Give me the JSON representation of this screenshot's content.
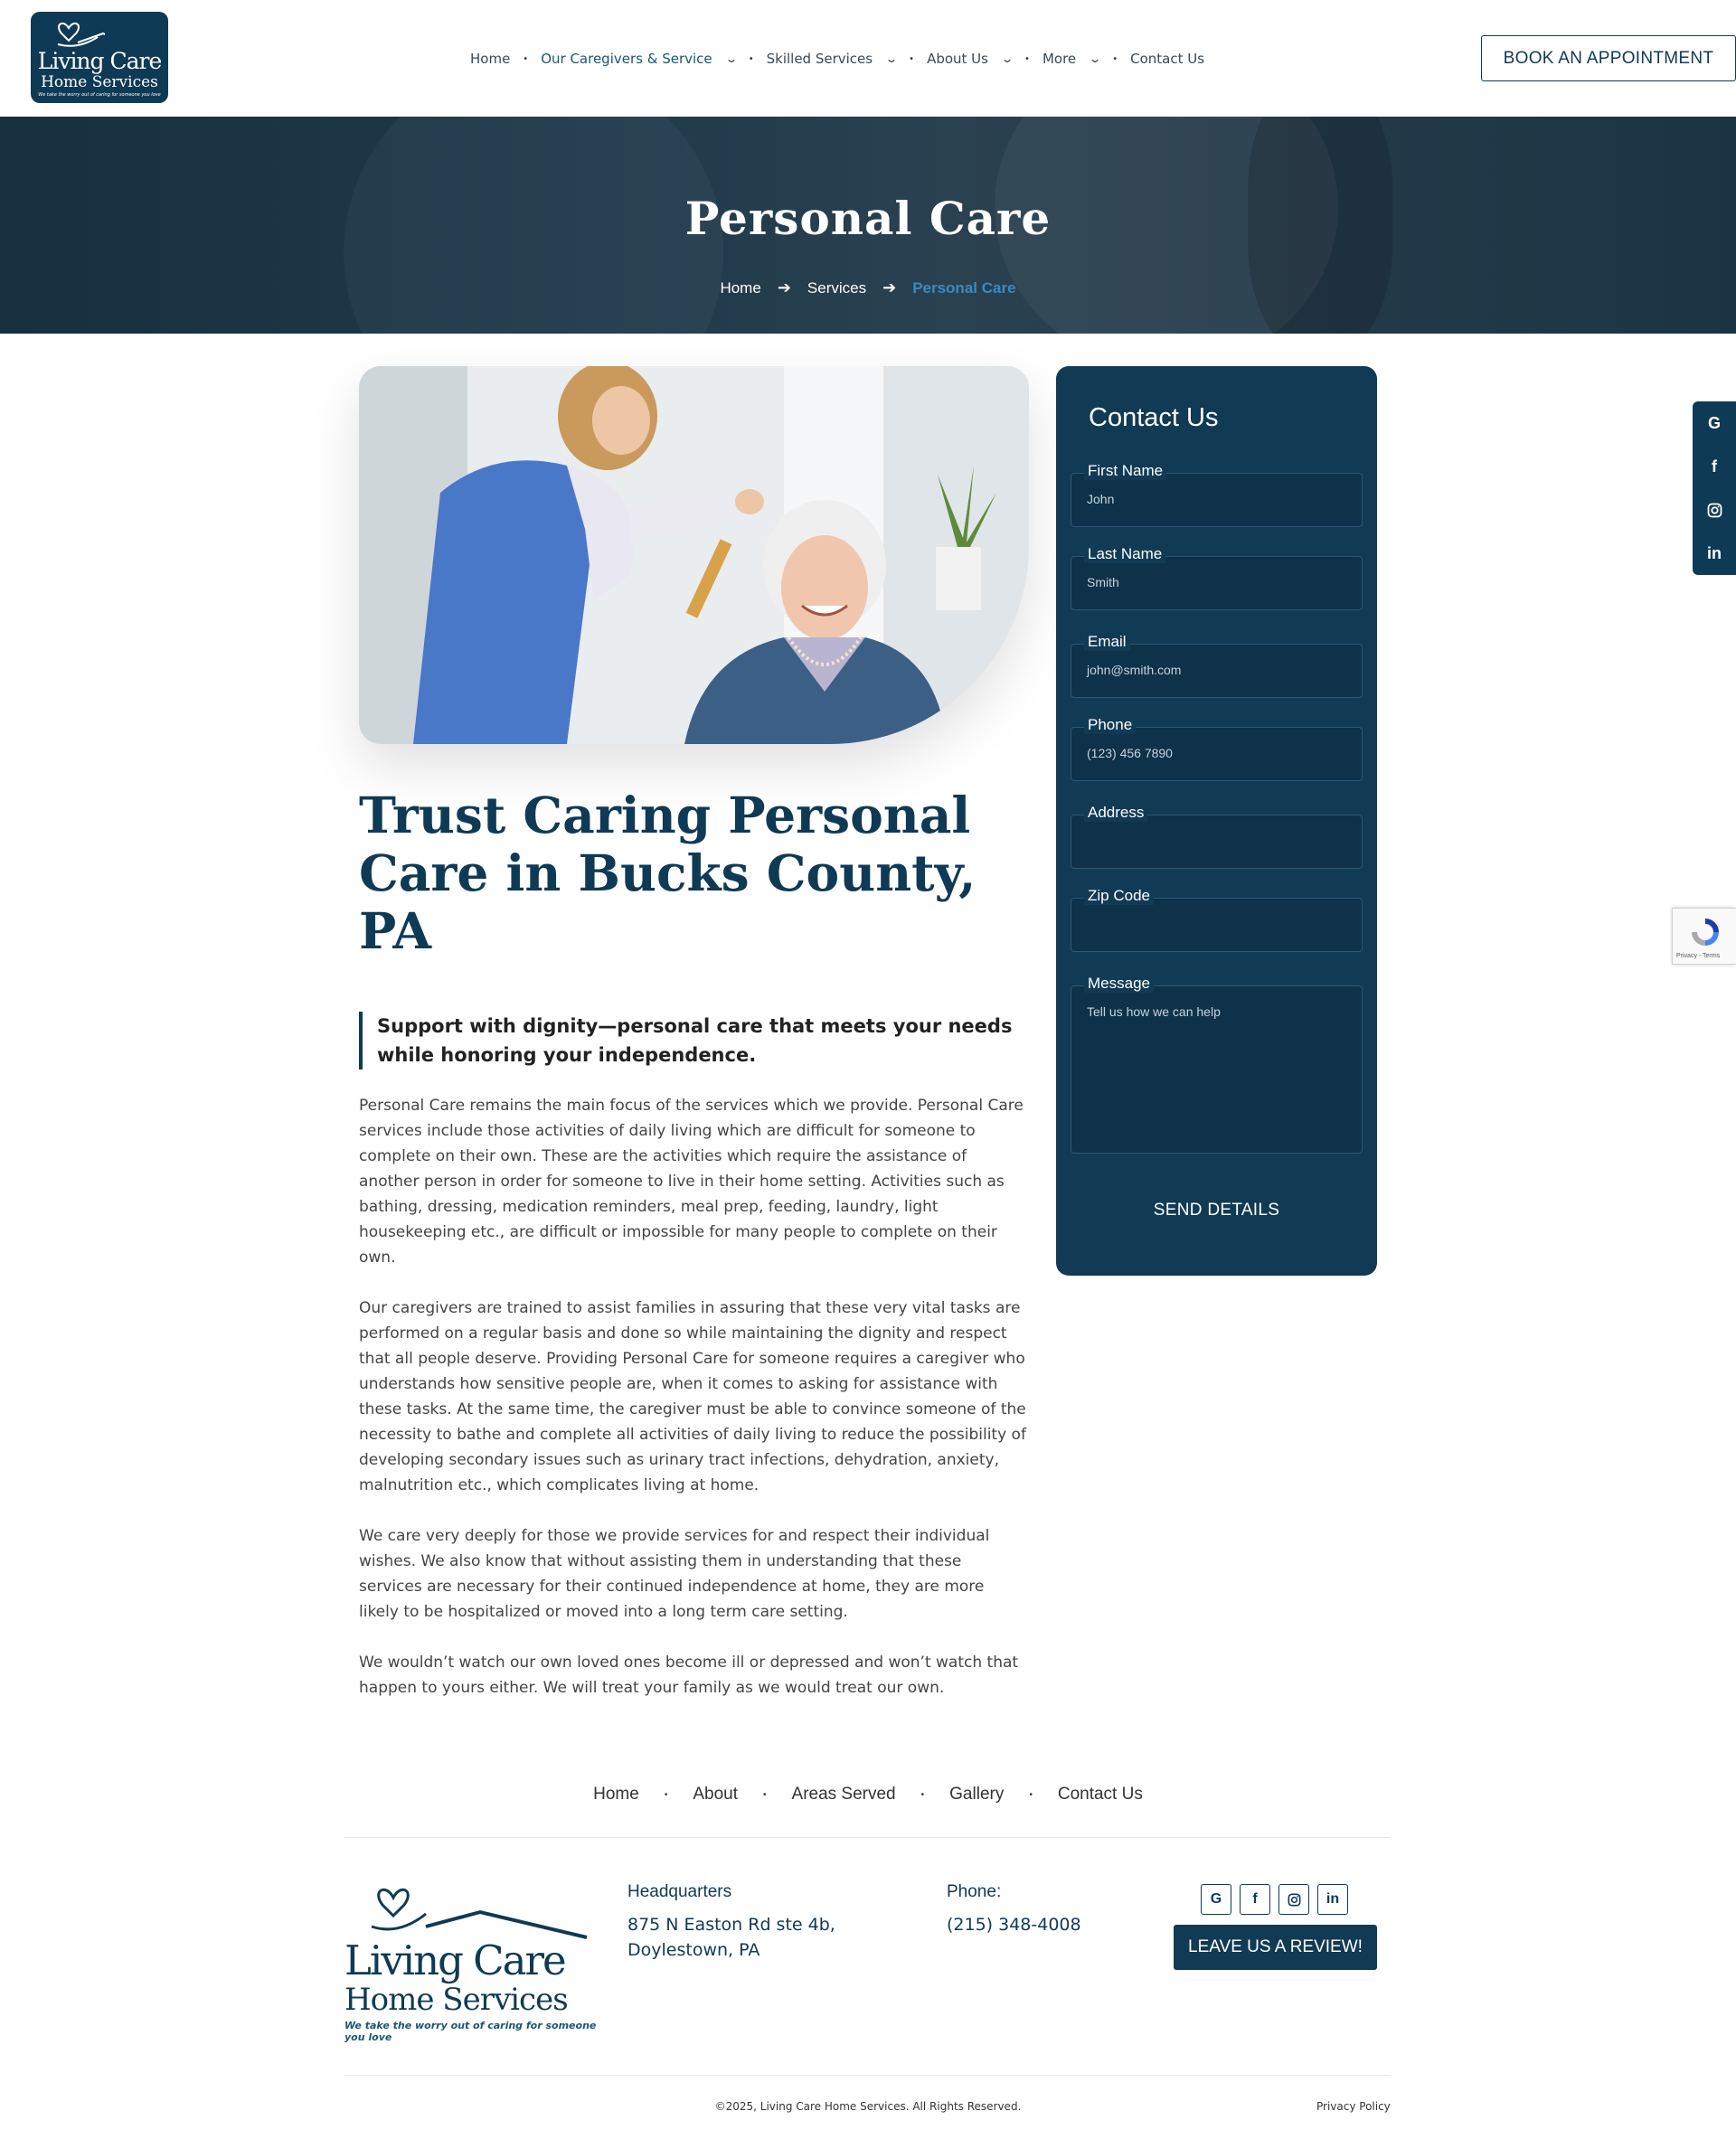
{
  "header": {
    "logo": {
      "line1": "Living Care",
      "line2": "Home Services",
      "tagline": "We take the worry out of caring for someone you love"
    },
    "nav": [
      {
        "label": "Home",
        "dropdown": false
      },
      {
        "label": "Our Caregivers & Service",
        "dropdown": true
      },
      {
        "label": "Skilled Services",
        "dropdown": true
      },
      {
        "label": "About Us",
        "dropdown": true
      },
      {
        "label": "More",
        "dropdown": true
      },
      {
        "label": "Contact Us",
        "dropdown": false
      }
    ],
    "book_label": "BOOK AN APPOINTMENT"
  },
  "hero": {
    "title": "Personal Care",
    "breadcrumb": [
      "Home",
      "Services",
      "Personal Care"
    ]
  },
  "article": {
    "title": "Trust Caring Personal Care in Bucks County, PA",
    "quote": "Support with dignity—personal care that meets your needs while honoring your independence.",
    "paragraphs": [
      "Personal Care remains the main focus of the services which we provide. Personal Care services include those activities of daily living which are difficult for someone to complete on their own. These are the activities which require the assistance of another person in order for someone to live in their home setting. Activities such as bathing, dressing, medication reminders, meal prep, feeding, laundry, light housekeeping etc., are difficult or impossible for many people to complete on their own.",
      "Our caregivers are trained to assist families in assuring that these very vital tasks are performed on a regular basis and done so while maintaining the dignity and respect that all people deserve. Providing Personal Care for someone requires a caregiver who understands how sensitive people are, when it comes to asking for assistance with these tasks. At the same time, the caregiver must be able to convince someone of the necessity to bathe and complete all activities of daily living to reduce the possibility of developing secondary issues such as urinary tract infections, dehydration, anxiety, malnutrition etc., which complicates living at home.",
      "We care very deeply for those we provide services for and respect their individual wishes. We also know that without assisting them in understanding that these services are necessary for their continued independence at home, they are more likely to be hospitalized or moved into a long term care setting.",
      "We wouldn’t watch our own loved ones become ill or depressed and won’t watch that happen to yours either. We will treat your family as we would treat our own."
    ]
  },
  "contact": {
    "title": "Contact Us",
    "fields": [
      {
        "label": "First Name",
        "placeholder": "John"
      },
      {
        "label": "Last Name",
        "placeholder": "Smith"
      },
      {
        "label": "Email",
        "placeholder": "john@smith.com"
      },
      {
        "label": "Phone",
        "placeholder": "(123) 456 7890"
      },
      {
        "label": "Address",
        "placeholder": ""
      },
      {
        "label": "Zip Code",
        "placeholder": ""
      },
      {
        "label": "Message",
        "placeholder": "Tell us how we can help"
      }
    ],
    "send_label": "SEND DETAILS"
  },
  "side_social": [
    "G",
    "f",
    "instagram",
    "in"
  ],
  "recaptcha": {
    "text": "Privacy - Terms"
  },
  "footer": {
    "nav": [
      "Home",
      "About",
      "Areas Served",
      "Gallery",
      "Contact Us"
    ],
    "logo": {
      "line1": "Living Care",
      "line2": "Home Services",
      "tagline": "We take the worry out of caring for someone you love"
    },
    "hq_heading": "Headquarters",
    "hq_line1": "875 N Easton Rd ste 4b,",
    "hq_line2": "Doylestown, PA",
    "phone_heading": "Phone:",
    "phone": "(215) 348-4008",
    "review_label": "LEAVE US A REVIEW!",
    "copyright": "©2025, Living Care Home Services. All Rights Reserved.",
    "privacy": "Privacy Policy"
  },
  "colors": {
    "brand": "#0f3a55",
    "accent": "#3a8ac0",
    "card": "#113a55"
  }
}
